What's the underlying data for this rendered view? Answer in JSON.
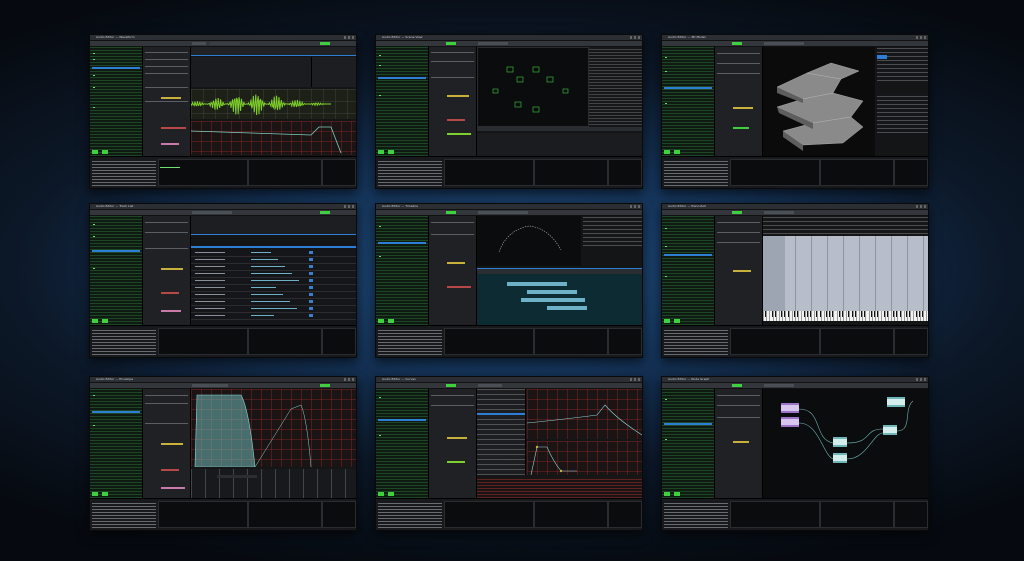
{
  "gallery": {
    "window_titles": [
      "Audio Editor — Waveform",
      "Audio Editor — Scene View",
      "Audio Editor — 3D Model",
      "Audio Editor — Track List",
      "Audio Editor — Timeline",
      "Audio Editor — Piano Roll",
      "Audio Editor — Envelope",
      "Audio Editor — Curves",
      "Audio Editor — Node Graph"
    ],
    "views": [
      "waveform",
      "scene",
      "model-3d",
      "tracklist",
      "timeline",
      "piano-roll",
      "envelope",
      "curves",
      "node-graph"
    ],
    "colors": {
      "background": "#143256",
      "waveform": "#7fd02a",
      "accent_green": "#3fcf3f",
      "selection_blue": "#2d7fd6",
      "timeline_clip": "#6fb0c9",
      "piano_roll_bg": "#b7bdc9",
      "node_purple": "#9b73c9",
      "node_teal": "#6fb7b7"
    }
  }
}
